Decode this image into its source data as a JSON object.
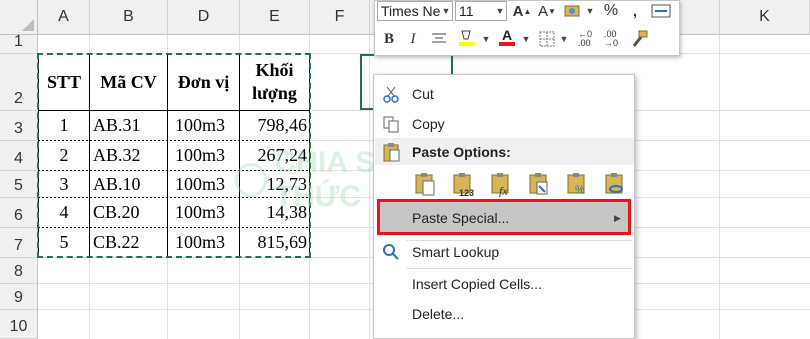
{
  "columns": [
    "A",
    "B",
    "D",
    "E",
    "F",
    "K"
  ],
  "rows": [
    "1",
    "2",
    "3",
    "4",
    "5",
    "6",
    "7",
    "8",
    "9",
    "10"
  ],
  "table": {
    "headers": [
      "STT",
      "Mã CV",
      "Đơn vị",
      "Khối",
      "lượng"
    ],
    "rows": [
      [
        "1",
        "AB.31",
        "100m3",
        "798,46"
      ],
      [
        "2",
        "AB.32",
        "100m3",
        "267,24"
      ],
      [
        "3",
        "AB.10",
        "100m3",
        "12,73"
      ],
      [
        "4",
        "CB.20",
        "100m3",
        "14,38"
      ],
      [
        "5",
        "CB.22",
        "100m3",
        "815,69"
      ]
    ]
  },
  "watermark": "CHIA SẺ KIẾN THỨC",
  "mini_toolbar": {
    "font_name": "Times Ne",
    "font_size": "11",
    "icons": [
      "increase-font",
      "decrease-font",
      "number-format",
      "percent",
      "comma",
      "wrap",
      "bold",
      "italic",
      "align-center",
      "fill-color",
      "font-color",
      "borders",
      "increase-decimal",
      "decrease-decimal",
      "format-painter"
    ],
    "fill_color": "#ffff00",
    "font_color": "#e8141b"
  },
  "context_menu": {
    "cut": "Cut",
    "copy": "Copy",
    "paste_options": "Paste Options:",
    "paste_special": "Paste Special...",
    "smart_lookup": "Smart Lookup",
    "insert_copied": "Insert Copied Cells...",
    "delete": "Delete..."
  },
  "colors": {
    "accent": "#217346",
    "highlight_box": "#e8141b",
    "hover": "#c6c6c6"
  }
}
